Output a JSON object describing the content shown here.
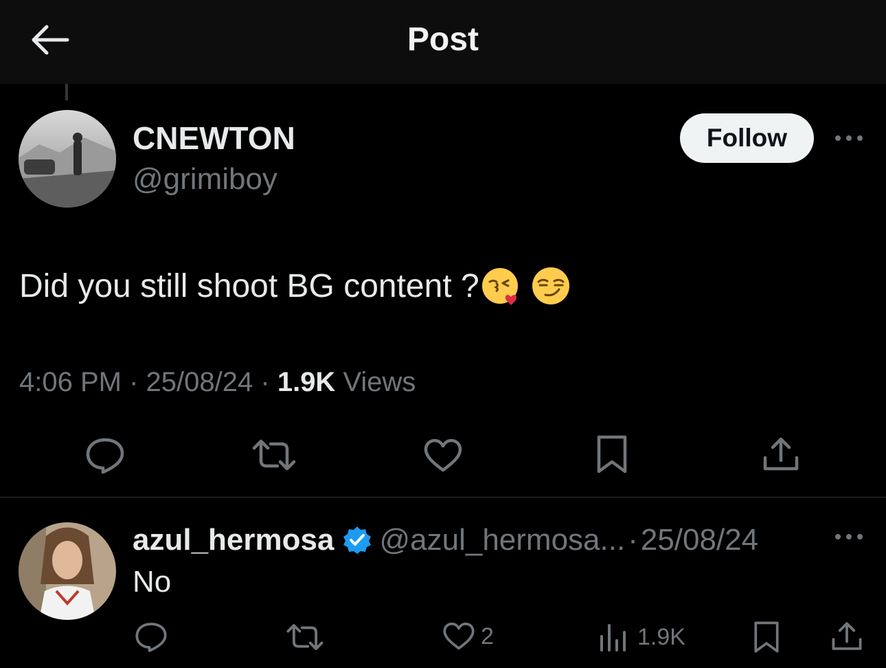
{
  "header": {
    "title": "Post"
  },
  "post": {
    "author_name": "CNEWTON",
    "author_handle": "@grimiboy",
    "follow_label": "Follow",
    "text": "Did you still shoot BG content ?",
    "emojis": [
      "face-blowing-kiss-icon",
      "smirking-face-icon"
    ],
    "time": "4:06 PM",
    "date": "25/08/24",
    "views_count": "1.9K",
    "views_label": "Views",
    "separator": "·"
  },
  "reply": {
    "author_name": "azul_hermosa",
    "verified": true,
    "author_handle": "@azul_hermosa...",
    "separator": "·",
    "date": "25/08/24",
    "text": "No",
    "like_count": "2",
    "views_count": "1.9K"
  },
  "colors": {
    "background": "#000000",
    "header_bg": "#0d0d0d",
    "text": "#e7e9ea",
    "muted": "#71767b",
    "verified_blue": "#1d9bf0",
    "follow_bg": "#eff3f4"
  }
}
